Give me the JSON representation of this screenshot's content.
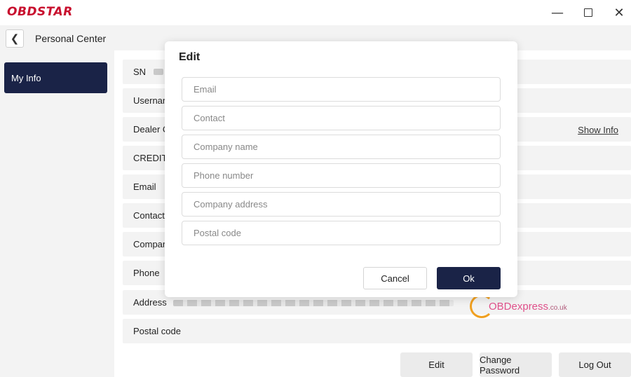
{
  "app": {
    "logo": "OBDSTAR"
  },
  "window_controls": {
    "minimize": "—",
    "close": "✕"
  },
  "header": {
    "title": "Personal Center",
    "back_icon": "chevron-left-icon"
  },
  "sidebar": {
    "items": [
      {
        "label": "My Info",
        "active": true
      }
    ]
  },
  "info_rows": [
    {
      "label": "SN"
    },
    {
      "label": "Usernar"
    },
    {
      "label": "Dealer C"
    },
    {
      "label": "CREDIT"
    },
    {
      "label": "Email"
    },
    {
      "label": "Contact"
    },
    {
      "label": "Compar"
    },
    {
      "label": "Phone"
    },
    {
      "label": "Address"
    },
    {
      "label": "Postal code"
    }
  ],
  "show_info_link": "Show Info",
  "buttons": {
    "edit": "Edit",
    "change_password": "Change Password",
    "log_out": "Log Out"
  },
  "modal": {
    "title": "Edit",
    "fields": [
      {
        "placeholder": "Email",
        "value": ""
      },
      {
        "placeholder": "Contact",
        "value": ""
      },
      {
        "placeholder": "Company name",
        "value": ""
      },
      {
        "placeholder": "Phone number",
        "value": ""
      },
      {
        "placeholder": "Company address",
        "value": ""
      },
      {
        "placeholder": "Postal code",
        "value": ""
      }
    ],
    "cancel": "Cancel",
    "ok": "Ok"
  },
  "watermark": {
    "main": "OBDexpress",
    "suffix": ".co.uk"
  },
  "colors": {
    "brand_red": "#c8102e",
    "accent_navy": "#1a2347",
    "row_bg": "#f3f3f3"
  }
}
